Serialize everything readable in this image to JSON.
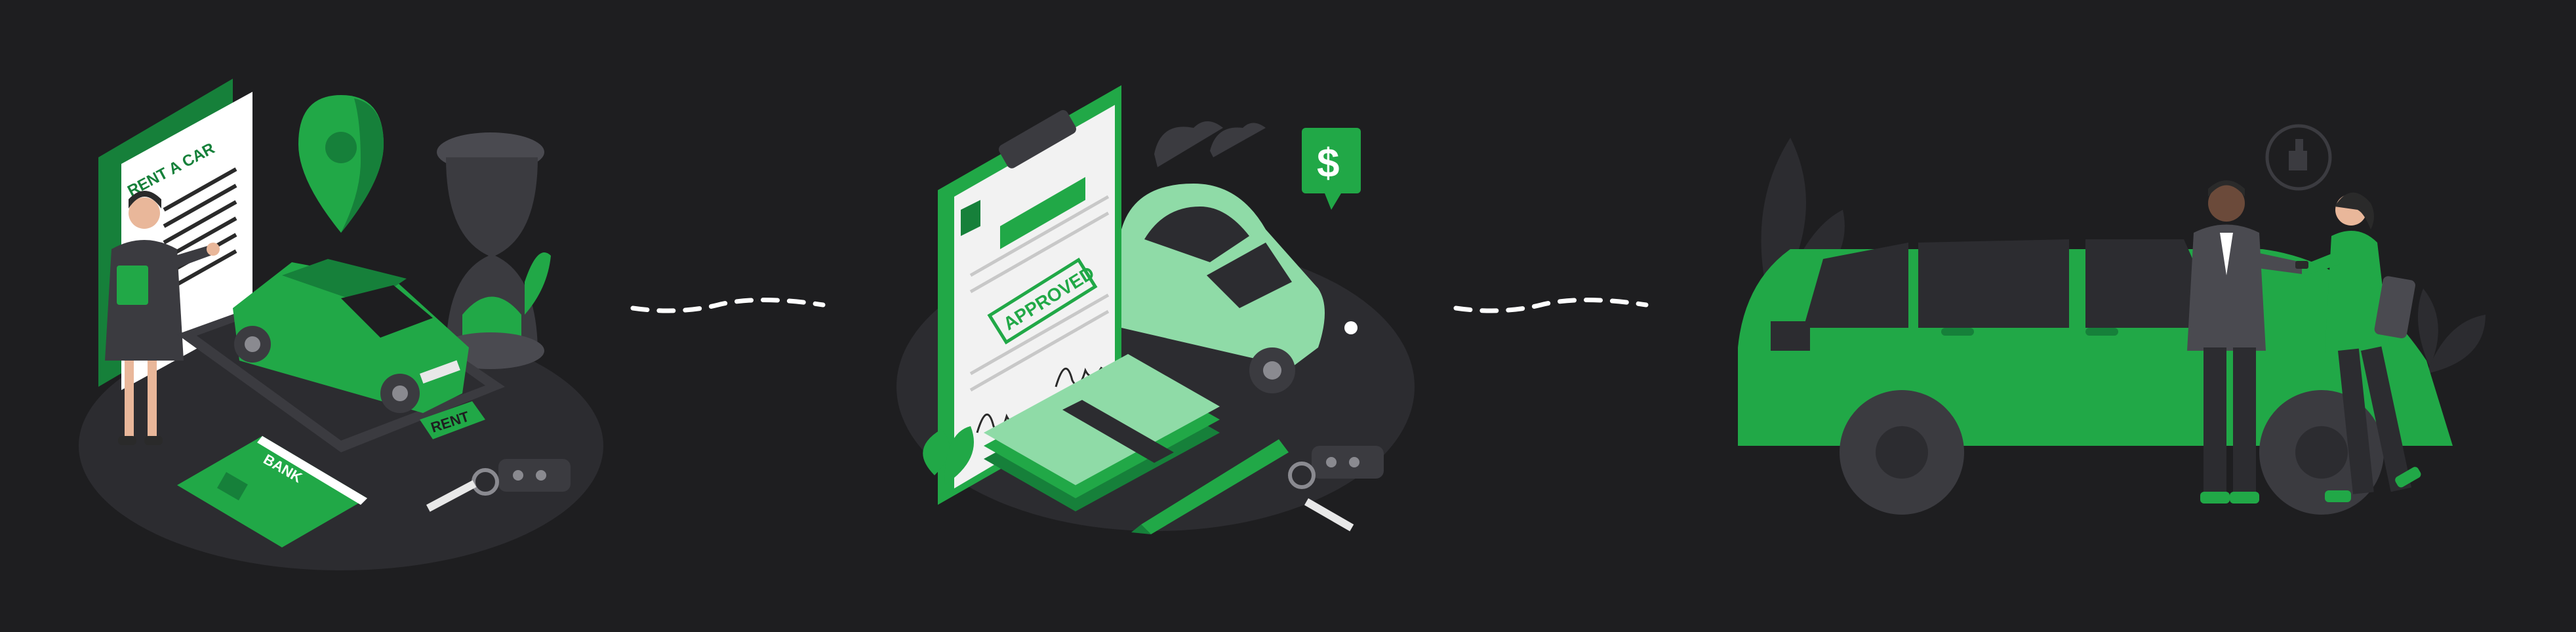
{
  "steps": [
    {
      "name": "rent",
      "document_title": "RENT A CAR",
      "card_label": "BANK",
      "phone_button_label": "RENT"
    },
    {
      "name": "approval",
      "stamp_label": "APPROVED",
      "price_bubble_symbol": "$"
    },
    {
      "name": "handover"
    }
  ],
  "colors": {
    "background": "#1e1e20",
    "accent": "#21a847",
    "accent_dark": "#16803a",
    "accent_light": "#8fdba7",
    "platform": "#2c2c30",
    "connector": "#ffffff"
  },
  "icons": [
    "location-pin-icon",
    "hourglass-icon",
    "car-key-icon",
    "credit-card-icon",
    "smartphone-icon",
    "clipboard-icon",
    "money-stack-icon",
    "pen-icon",
    "dollar-bubble-icon",
    "thumbs-up-bubble-icon",
    "plant-icon"
  ]
}
